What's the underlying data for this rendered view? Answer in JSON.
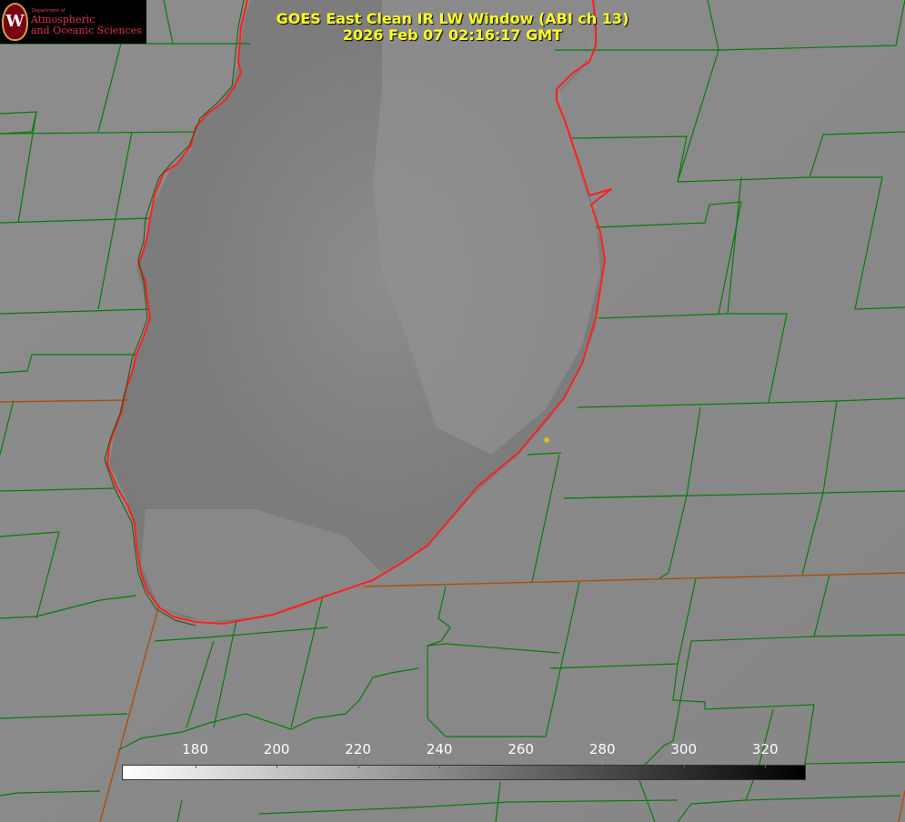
{
  "title": {
    "line1": "GOES East Clean IR LW Window (ABI ch 13)",
    "line2": "2026 Feb 07 02:16:17 GMT"
  },
  "logo": {
    "seal_letter": "W",
    "line1": "Department of",
    "line2": "Atmospheric",
    "line3": "and Oceanic Sciences"
  },
  "colorbar": {
    "min": 162,
    "max": 330,
    "start_color": "#ffffff",
    "end_color": "#000000",
    "ticks": [
      180,
      200,
      220,
      240,
      260,
      280,
      300,
      320
    ]
  },
  "colors": {
    "county_lines": "#0a7a0a",
    "state_lines": "#b8400a",
    "lake_shoreline": "#ff2020",
    "title_text": "#ffff22",
    "marker": "#d4c020"
  },
  "icons": [
    "uw-seal-icon",
    "station-marker-icon"
  ]
}
